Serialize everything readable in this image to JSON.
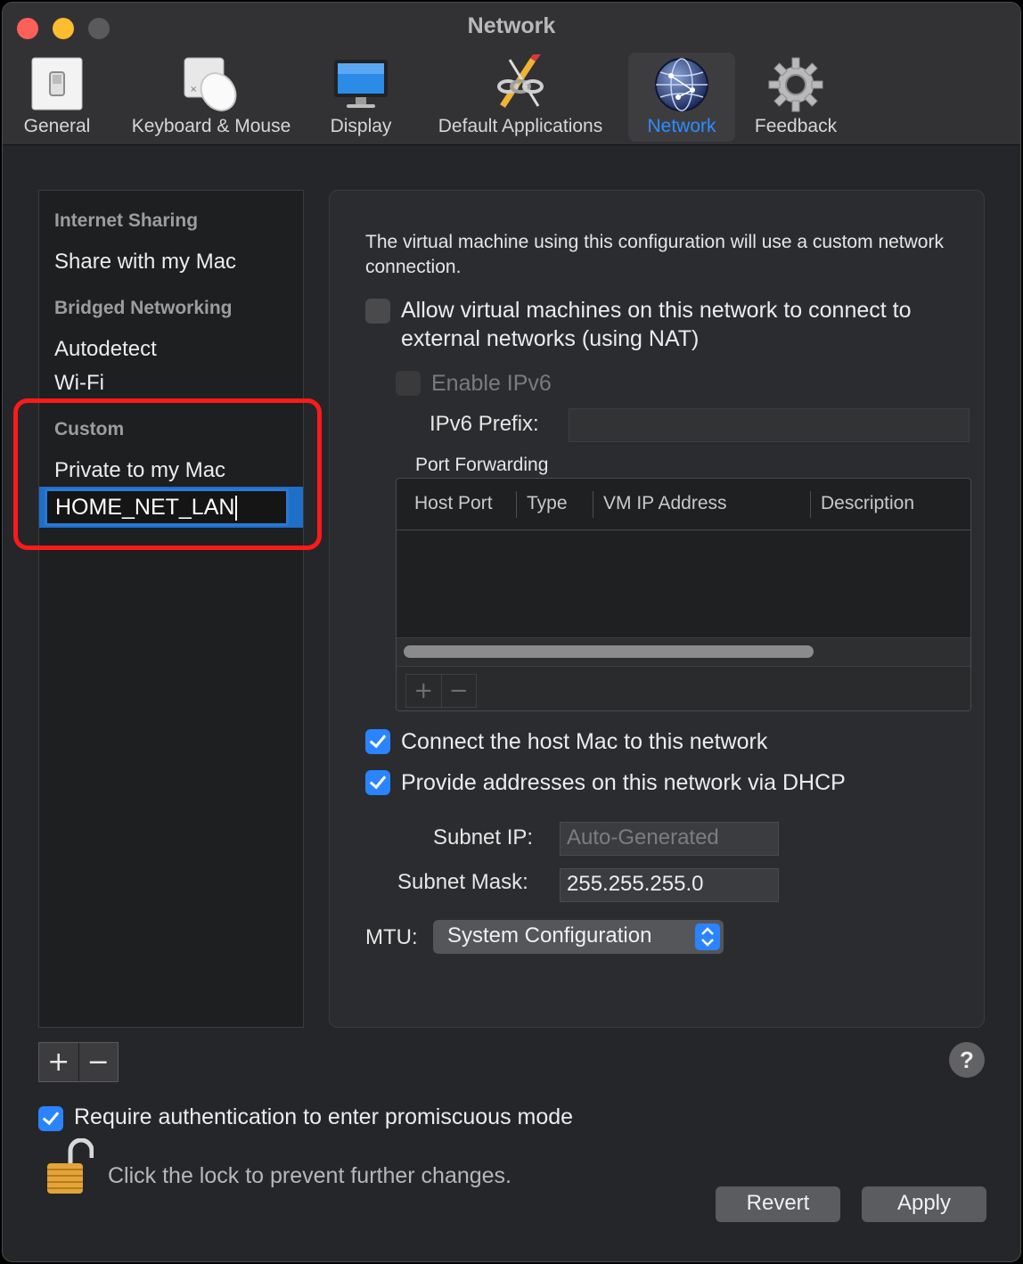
{
  "window": {
    "title": "Network"
  },
  "toolbar": {
    "items": [
      {
        "label": "General",
        "icon": "switch-icon"
      },
      {
        "label": "Keyboard & Mouse",
        "icon": "mouse-icon"
      },
      {
        "label": "Display",
        "icon": "monitor-icon"
      },
      {
        "label": "Default Applications",
        "icon": "chain-pencil-icon"
      },
      {
        "label": "Network",
        "icon": "globe-icon",
        "active": true
      },
      {
        "label": "Feedback",
        "icon": "gear-icon"
      }
    ]
  },
  "sidebar": {
    "groups": [
      {
        "header": "Internet Sharing",
        "items": [
          "Share with my Mac"
        ]
      },
      {
        "header": "Bridged Networking",
        "items": [
          "Autodetect",
          "Wi-Fi"
        ]
      },
      {
        "header": "Custom",
        "items": [
          "Private to my Mac"
        ]
      }
    ],
    "editing_value": "HOME_NET_LAN",
    "add_label": "+",
    "remove_label": "−"
  },
  "panel": {
    "description": "The virtual machine using this configuration will use a custom network connection.",
    "nat": {
      "label": "Allow virtual machines on this network to connect to external networks (using NAT)",
      "checked": false
    },
    "ipv6": {
      "label": "Enable IPv6",
      "checked": false,
      "disabled": true
    },
    "ipv6_prefix": {
      "label": "IPv6 Prefix:",
      "value": ""
    },
    "port_forwarding": {
      "label": "Port Forwarding",
      "columns": [
        "Host Port",
        "Type",
        "VM IP Address",
        "Description"
      ],
      "rows": [],
      "add_label": "+",
      "remove_label": "−"
    },
    "connect_host": {
      "label": "Connect the host Mac to this network",
      "checked": true
    },
    "dhcp": {
      "label": "Provide addresses on this network via DHCP",
      "checked": true
    },
    "subnet_ip": {
      "label": "Subnet IP:",
      "placeholder": "Auto-Generated"
    },
    "subnet_mask": {
      "label": "Subnet Mask:",
      "value": "255.255.255.0"
    },
    "mtu": {
      "label": "MTU:",
      "value": "System Configuration"
    }
  },
  "footer": {
    "help_label": "?",
    "promiscuous": {
      "label": "Require authentication to enter promiscuous mode",
      "checked": true
    },
    "lock_text": "Click the lock to prevent further changes.",
    "revert_label": "Revert",
    "apply_label": "Apply"
  },
  "colors": {
    "accent": "#2a84ff",
    "highlight": "#ff1a1a"
  }
}
